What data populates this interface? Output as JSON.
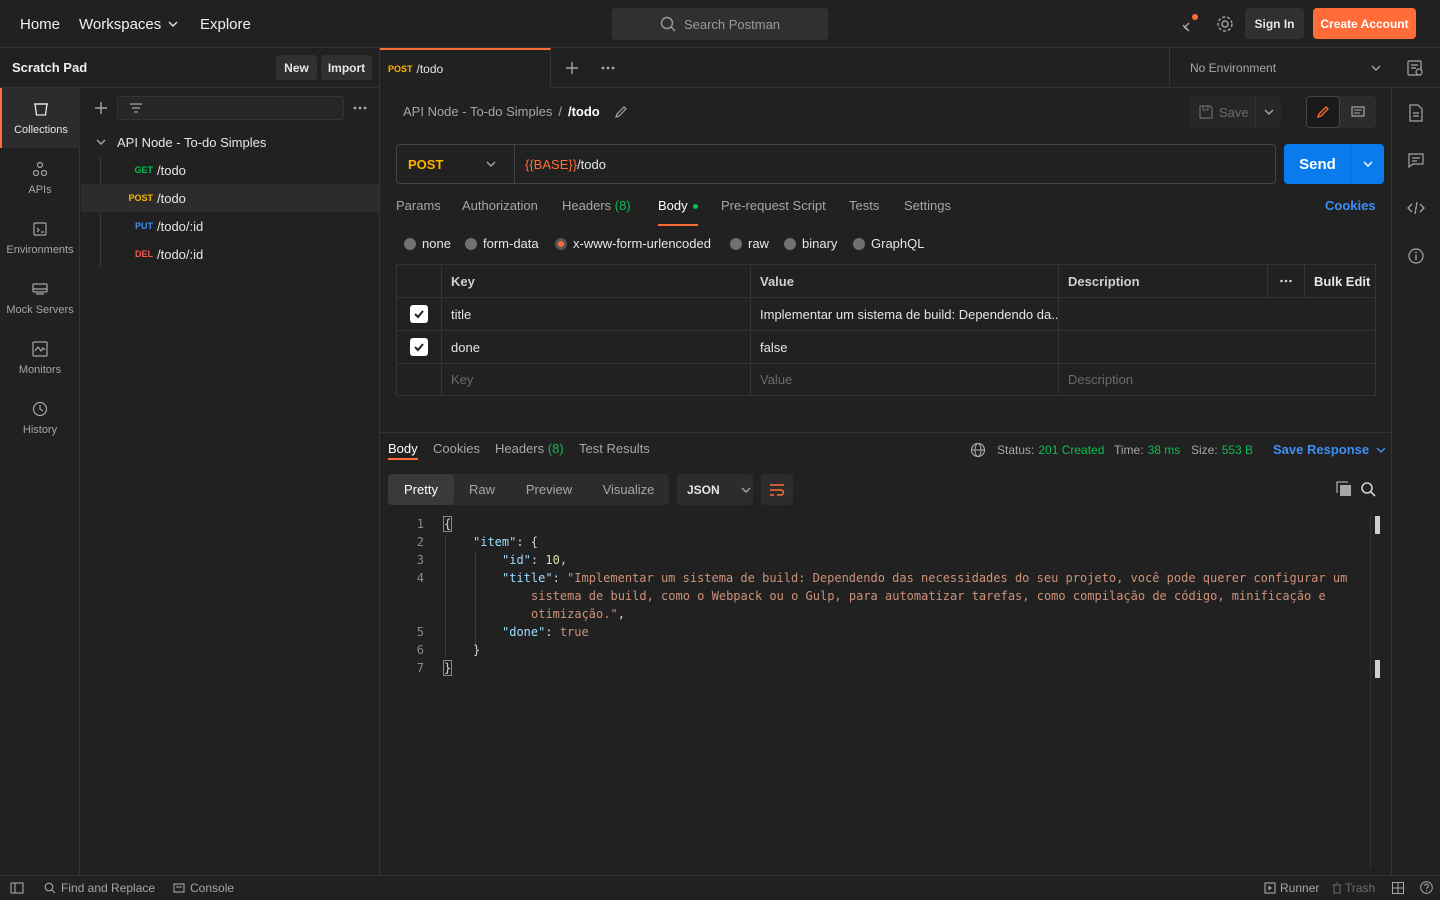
{
  "nav": {
    "home": "Home",
    "workspaces": "Workspaces",
    "explore": "Explore"
  },
  "search": {
    "placeholder": "Search Postman"
  },
  "header": {
    "sign_in": "Sign In",
    "create_account": "Create Account"
  },
  "sidebar": {
    "title": "Scratch Pad",
    "new_label": "New",
    "import_label": "Import",
    "rail": [
      {
        "label": "Collections",
        "icon": "collections-icon"
      },
      {
        "label": "APIs",
        "icon": "apis-icon"
      },
      {
        "label": "Environments",
        "icon": "environments-icon"
      },
      {
        "label": "Mock Servers",
        "icon": "mock-servers-icon"
      },
      {
        "label": "Monitors",
        "icon": "monitors-icon"
      },
      {
        "label": "History",
        "icon": "history-icon"
      }
    ],
    "collection": "API Node - To-do Simples",
    "requests": [
      {
        "method": "GET",
        "path": "/todo",
        "color": "#0cbb52"
      },
      {
        "method": "POST",
        "path": "/todo",
        "color": "#ffb400"
      },
      {
        "method": "PUT",
        "path": "/todo/:id",
        "color": "#097bed"
      },
      {
        "method": "DEL",
        "path": "/todo/:id",
        "color": "#eb2013"
      }
    ]
  },
  "tab": {
    "method": "POST",
    "path": "/todo"
  },
  "environment": "No Environment",
  "breadcrumb": {
    "collection": "API Node - To-do Simples",
    "separator": "/",
    "request": "/todo"
  },
  "save_label": "Save",
  "request": {
    "method": "POST",
    "url_var": "{{BASE}}",
    "url_path": "/todo",
    "send_label": "Send",
    "tabs": [
      "Params",
      "Authorization",
      "Headers",
      "(8)",
      "Body",
      "Pre-request Script",
      "Tests",
      "Settings"
    ],
    "cookies": "Cookies",
    "body_types": [
      "none",
      "form-data",
      "x-www-form-urlencoded",
      "raw",
      "binary",
      "GraphQL"
    ],
    "selected_body_type": "x-www-form-urlencoded",
    "table": {
      "headers": {
        "key": "Key",
        "value": "Value",
        "description": "Description",
        "bulk_edit": "Bulk Edit"
      },
      "rows": [
        {
          "checked": true,
          "key": "title",
          "value": "Implementar um sistema de build: Dependendo da..."
        },
        {
          "checked": true,
          "key": "done",
          "value": "false"
        }
      ],
      "placeholder": {
        "key": "Key",
        "value": "Value",
        "description": "Description"
      }
    }
  },
  "response": {
    "tabs": {
      "body": "Body",
      "cookies": "Cookies",
      "headers": "Headers",
      "headers_count": "(8)",
      "tests": "Test Results"
    },
    "status_label": "Status:",
    "status_value": "201 Created",
    "time_label": "Time:",
    "time_value": "38 ms",
    "size_label": "Size:",
    "size_value": "553 B",
    "save_response": "Save Response",
    "views": [
      "Pretty",
      "Raw",
      "Preview",
      "Visualize"
    ],
    "format": "JSON",
    "lines": [
      "1",
      "2",
      "3",
      "4",
      "5",
      "6",
      "7"
    ],
    "code": {
      "open": "{",
      "item_key": "\"item\"",
      "item_open": ": {",
      "id_key": "\"id\"",
      "id_val": "10",
      "title_key": "\"title\"",
      "title_val_1": "\"Implementar um sistema de build: Dependendo das necessidades do seu projeto, você pode querer configurar um",
      "title_val_2": "sistema de build, como o Webpack ou o Gulp, para automatizar tarefas, como compilação de código, minificação e",
      "title_val_3": "otimização.\"",
      "done_key": "\"done\"",
      "done_val": "true",
      "item_close": "}",
      "close": "}"
    }
  },
  "statusbar": {
    "find_replace": "Find and Replace",
    "console": "Console",
    "runner": "Runner",
    "trash": "Trash"
  }
}
